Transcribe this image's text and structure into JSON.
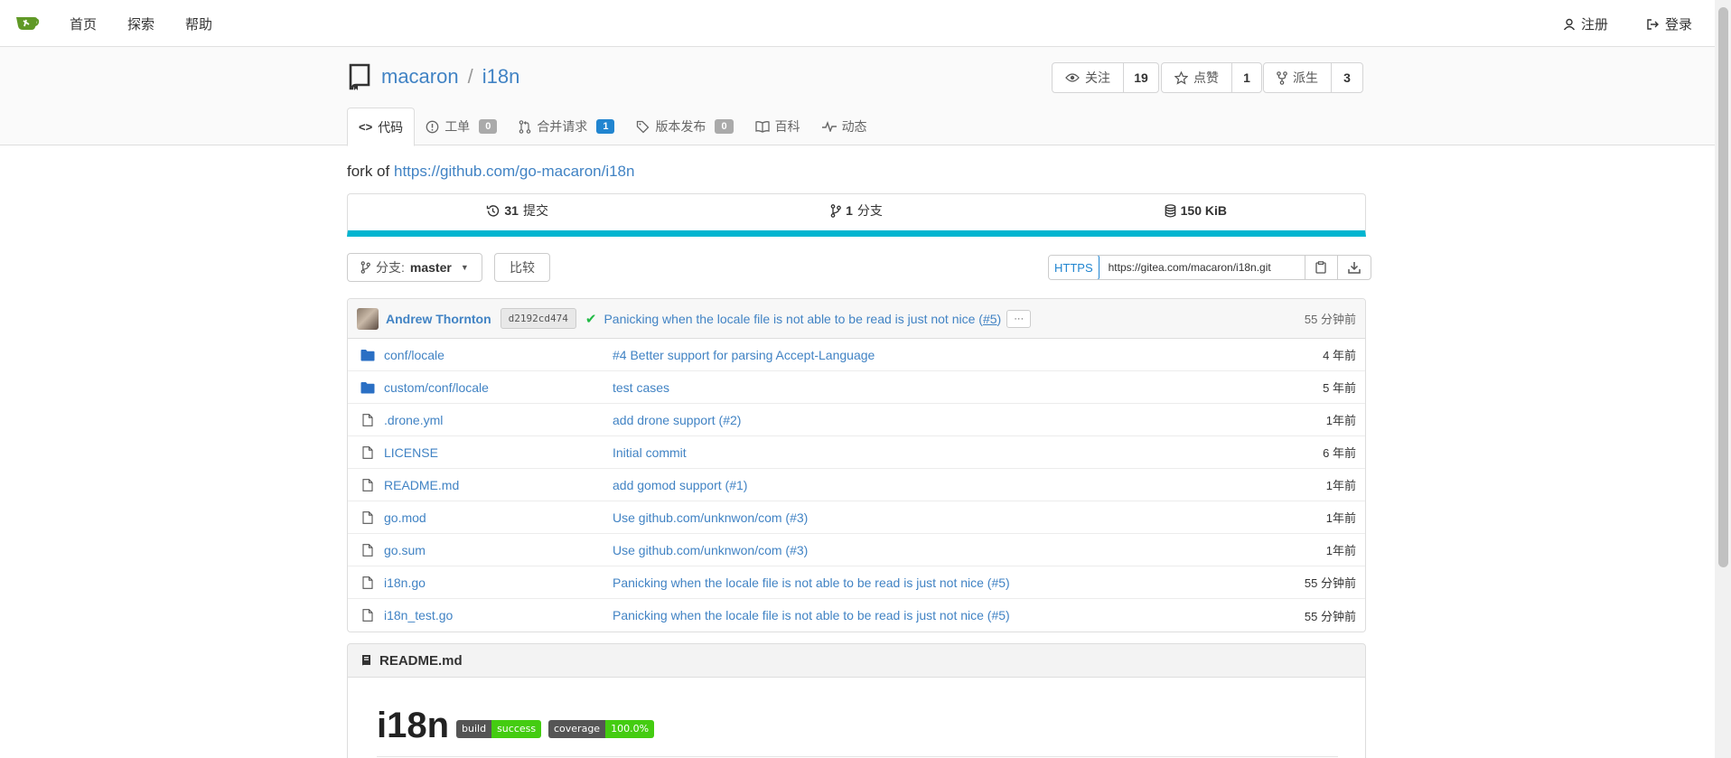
{
  "nav": {
    "home": "首页",
    "explore": "探索",
    "help": "帮助",
    "register": "注册",
    "login": "登录"
  },
  "repo": {
    "owner": "macaron",
    "name": "i18n",
    "watch_label": "关注",
    "watch_count": "19",
    "star_label": "点赞",
    "star_count": "1",
    "fork_label": "派生",
    "fork_count": "3"
  },
  "tabs": {
    "code": "代码",
    "issues": "工单",
    "issues_count": "0",
    "pulls": "合并请求",
    "pulls_count": "1",
    "releases": "版本发布",
    "releases_count": "0",
    "wiki": "百科",
    "activity": "动态"
  },
  "fork_of": {
    "prefix": "fork of",
    "url": "https://github.com/go-macaron/i18n"
  },
  "stats": {
    "commits_num": "31",
    "commits_label": "提交",
    "branches_num": "1",
    "branches_label": "分支",
    "size": "150 KiB"
  },
  "branch": {
    "label": "分支:",
    "name": "master",
    "compare": "比较"
  },
  "clone": {
    "protocol": "HTTPS",
    "url": "https://gitea.com/macaron/i18n.git"
  },
  "latest_commit": {
    "author": "Andrew Thornton",
    "sha": "d2192cd474",
    "message": "Panicking when the locale file is not able to be read is just not nice (",
    "pr": "#5",
    "message_end": ")",
    "ellipsis": "···",
    "age": "55 分钟前"
  },
  "files": [
    {
      "name": "conf/locale",
      "type": "dir",
      "message": "#4 Better support for parsing Accept-Language",
      "age": "4 年前"
    },
    {
      "name": "custom/conf/locale",
      "type": "dir",
      "message": "test cases",
      "age": "5 年前"
    },
    {
      "name": ".drone.yml",
      "type": "file",
      "message": "add drone support (#2)",
      "age": "1年前"
    },
    {
      "name": "LICENSE",
      "type": "file",
      "message": "Initial commit",
      "age": "6 年前"
    },
    {
      "name": "README.md",
      "type": "file",
      "message": "add gomod support (#1)",
      "age": "1年前"
    },
    {
      "name": "go.mod",
      "type": "file",
      "message": "Use github.com/unknwon/com (#3)",
      "age": "1年前"
    },
    {
      "name": "go.sum",
      "type": "file",
      "message": "Use github.com/unknwon/com (#3)",
      "age": "1年前"
    },
    {
      "name": "i18n.go",
      "type": "file",
      "message": "Panicking when the locale file is not able to be read is just not nice (#5)",
      "age": "55 分钟前"
    },
    {
      "name": "i18n_test.go",
      "type": "file",
      "message": "Panicking when the locale file is not able to be read is just not nice (#5)",
      "age": "55 分钟前"
    }
  ],
  "readme": {
    "filename": "README.md",
    "title": "i18n",
    "badge_build_left": "build",
    "badge_build_right": "success",
    "badge_cov_left": "coverage",
    "badge_cov_right": "100.0%"
  },
  "colors": {
    "link": "#4183c4",
    "accent_bar": "#00b5d0",
    "success": "#21ba45",
    "badge_green": "#44cc11"
  }
}
